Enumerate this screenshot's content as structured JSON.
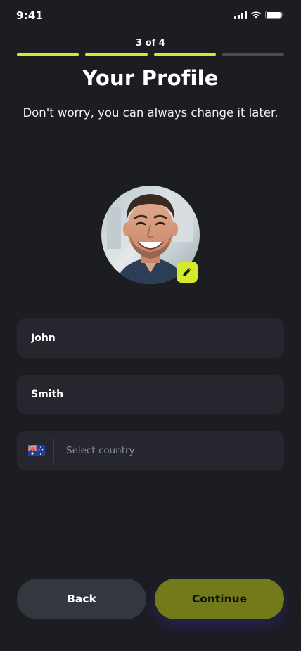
{
  "status_bar": {
    "time": "9:41"
  },
  "progress": {
    "label": "3 of 4",
    "current_step": 3,
    "total_steps": 4,
    "accent_color": "#d6ea2c"
  },
  "header": {
    "title": "Your Profile",
    "subtitle": "Don't worry, you can always change it later."
  },
  "avatar": {
    "edit_icon": "pencil-icon"
  },
  "form": {
    "first_name_value": "John",
    "last_name_value": "Smith",
    "country_flag": "australia-flag-icon",
    "country_placeholder": "Select country"
  },
  "actions": {
    "back_label": "Back",
    "continue_label": "Continue"
  }
}
